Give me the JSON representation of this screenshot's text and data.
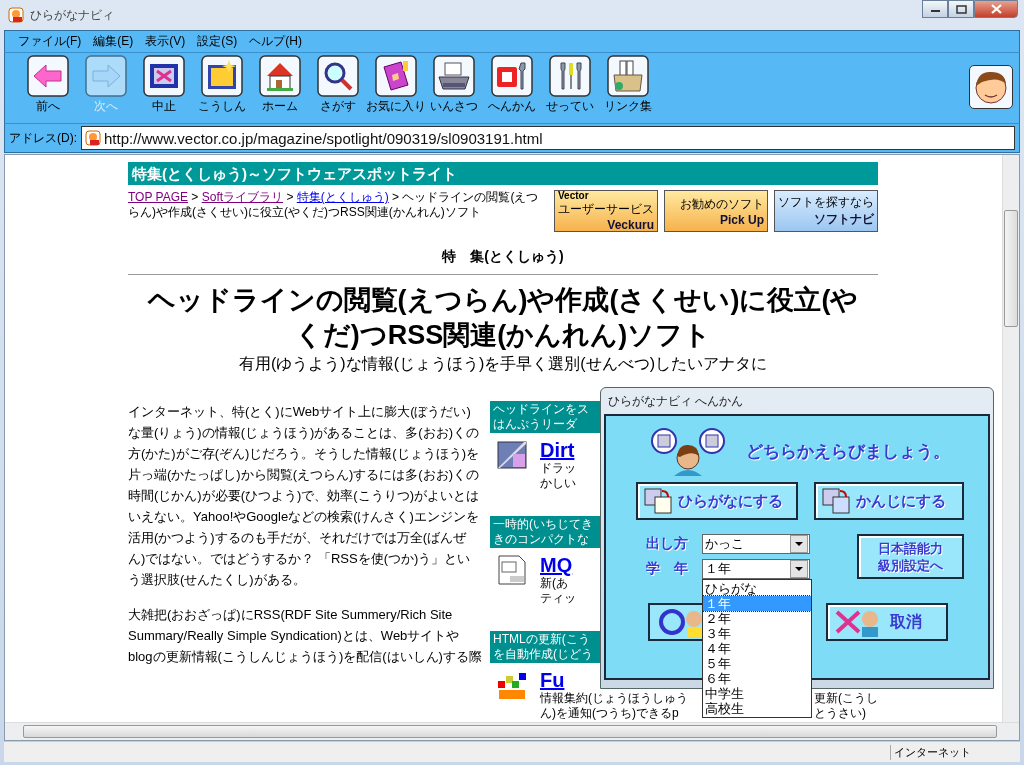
{
  "window": {
    "title": "ひらがなナビィ"
  },
  "menu": [
    {
      "label": "ファイル(F)"
    },
    {
      "label": "編集(E)"
    },
    {
      "label": "表示(V)"
    },
    {
      "label": "設定(S)"
    },
    {
      "label": "ヘルプ(H)"
    }
  ],
  "toolbar": [
    {
      "label": "前へ",
      "disabled": false
    },
    {
      "label": "次へ",
      "disabled": true
    },
    {
      "label": "中止",
      "disabled": false
    },
    {
      "label": "こうしん",
      "disabled": false
    },
    {
      "label": "ホーム",
      "disabled": false
    },
    {
      "label": "さがす",
      "disabled": false
    },
    {
      "label": "お気に入り",
      "disabled": false
    },
    {
      "label": "いんさつ",
      "disabled": false
    },
    {
      "label": "へんかん",
      "disabled": false
    },
    {
      "label": "せってい",
      "disabled": false
    },
    {
      "label": "リンク集",
      "disabled": false
    }
  ],
  "address": {
    "label": "アドレス(D):",
    "value": "http://www.vector.co.jp/magazine/spotlight/090319/sl0903191.html"
  },
  "page": {
    "section_bar": "特集(とくしゅう)～ソフトウェアスポットライト",
    "breadcrumb": [
      {
        "kind": "link",
        "text": "TOP PAGE",
        "visited": true
      },
      {
        "kind": "text",
        "text": " > "
      },
      {
        "kind": "link",
        "text": "Softライブラリ",
        "visited": true
      },
      {
        "kind": "text",
        "text": " > "
      },
      {
        "kind": "link",
        "text": "特集(とくしゅう)",
        "visited": false
      },
      {
        "kind": "text",
        "text": " > ヘッドラインの閲覧(えつらん)や作成(さくせい)に役立(やくだ)つRSS関連(かんれん)ソフト"
      }
    ],
    "banners": [
      {
        "brand": "Vector",
        "caption": "ユーザーサービス",
        "title": "Veckuru"
      },
      {
        "caption": "お勧めのソフト",
        "title": "Pick Up"
      },
      {
        "caption": "ソフトを探すなら",
        "title": "ソフトナビ"
      }
    ],
    "feature_label": "特　集(とくしゅう)",
    "headline": "ヘッドラインの閲覧(えつらん)や作成(さくせい)に役立(やくだ)つRSS関連(かんれん)ソフト",
    "subtitle": "有用(ゆうよう)な情報(じょうほう)を手早く選別(せんべつ)したいアナタに",
    "paragraphs": [
      "インターネット、特(とく)にWebサイト上に膨大(ぼうだい)な量(りょう)の情報(じょうほう)があることは、多(おお)くの方(かた)がご存(ぞん)じだろう。そうした情報(じょうほう)を片っ端(かたっぱし)から閲覧(えつらん)するには多(おお)くの時間(じかん)が必要(ひつよう)で、効率(こうりつ)がよいとはいえない。Yahoo!やGoogleなどの検索(けんさく)エンジンを活用(かつよう)するのも手だが、それだけでは万全(ばんぜん)ではない。ではどうするか？ 「RSSを使(つか)う」という選択肢(せんたくし)がある。",
      "大雑把(おおざっぱ)にRSS(RDF Site Summery/Rich Site Summary/Really Simple Syndication)とは、Webサイトやblogの更新情報(こうしんじょうほう)を配信(はいしん)する際"
    ],
    "side_sections": [
      {
        "heading": [
          "ヘッドラインをス",
          "はんぷうリーダ"
        ],
        "link": "Dirt",
        "desc_lines": [
          [
            "ドラッ"
          ],
          [
            "かしい"
          ]
        ]
      },
      {
        "heading": [
          "一時的(いちじてき",
          "きのコンパクトな"
        ],
        "link": "MQ",
        "desc_lines": [
          [
            "新(あ"
          ],
          [
            "ティッ"
          ]
        ]
      },
      {
        "heading": [
          "HTMLの更新(こう",
          "を自動作成(じどう"
        ],
        "link": "Fu",
        "desc_lines": [
          [
            "情報集約(じょうほうしゅう",
            "更新(こうし"
          ],
          [
            "ん)を通知(つうち)できるp",
            "とうさい)"
          ]
        ]
      }
    ]
  },
  "dialog": {
    "title": "ひらがなナビィ へんかん",
    "prompt": "どちらかえらびましょう。",
    "choices": [
      {
        "label": "ひらがなにする"
      },
      {
        "label": "かんじにする"
      }
    ],
    "fields": [
      {
        "label": "出し方",
        "value": "かっこ",
        "open": false
      },
      {
        "label": "学　年",
        "value": "１年",
        "open": true,
        "options": [
          {
            "label": "ひらがな",
            "selected": false
          },
          {
            "label": "１年",
            "selected": true
          },
          {
            "label": "２年",
            "selected": false
          },
          {
            "label": "３年",
            "selected": false
          },
          {
            "label": "４年",
            "selected": false
          },
          {
            "label": "５年",
            "selected": false
          },
          {
            "label": "６年",
            "selected": false
          },
          {
            "label": "中学生",
            "selected": false
          },
          {
            "label": "高校生",
            "selected": false
          }
        ]
      }
    ],
    "level_button": "日本語能力級別設定へ",
    "cancel": "取消"
  },
  "status_bar": {
    "zone": "インターネット"
  }
}
